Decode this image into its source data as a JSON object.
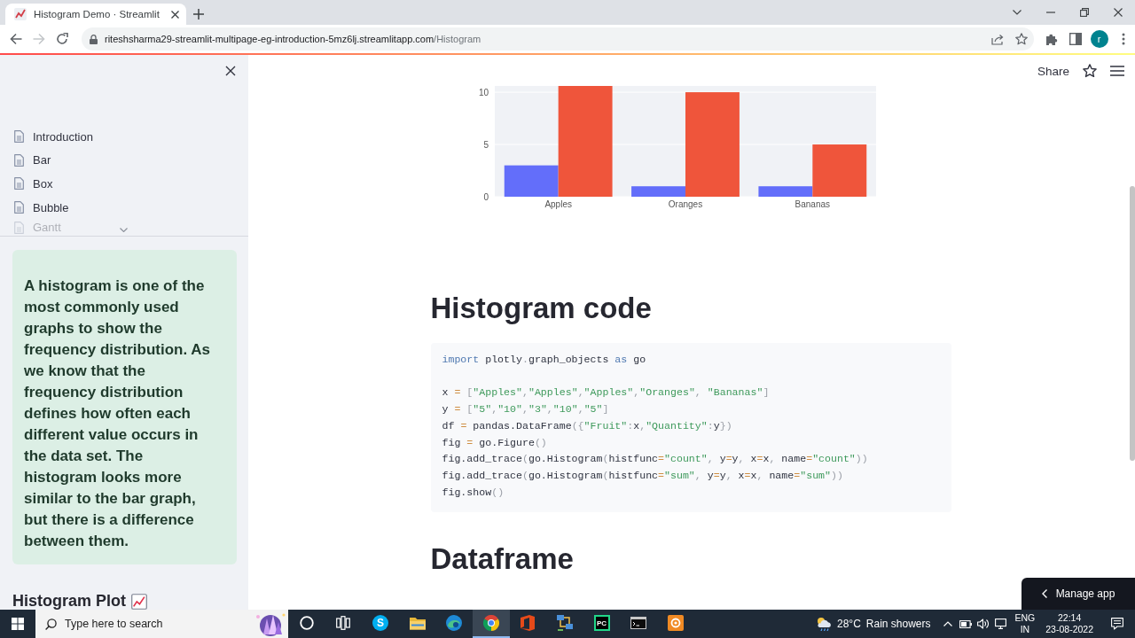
{
  "browser": {
    "tab": {
      "title": "Histogram Demo · Streamlit",
      "selected": true
    },
    "nav_buttons": [
      {
        "kind": "back",
        "disabled": false
      },
      {
        "kind": "forward",
        "disabled": true
      },
      {
        "kind": "reload",
        "disabled": false
      }
    ],
    "url": {
      "host": "riteshsharma29-streamlit-multipage-eg-introduction-5mz6lj.streamlitapp.com",
      "path": "/Histogram"
    },
    "profile_initial": "r"
  },
  "sidebar": {
    "nav_items": [
      {
        "label": "Introduction",
        "selected": false,
        "faded": false
      },
      {
        "label": "Bar",
        "selected": false,
        "faded": false
      },
      {
        "label": "Box",
        "selected": false,
        "faded": false
      },
      {
        "label": "Bubble",
        "selected": false,
        "faded": false
      },
      {
        "label": "Gantt",
        "selected": false,
        "faded": true
      }
    ],
    "callout": "A histogram is one of the most commonly used graphs to show the frequency distribution. As we know that the frequency distribution defines how often each different value occurs in the data set. The histogram looks more similar to the bar graph, but there is a difference between them.",
    "heading": "Histogram Plot"
  },
  "header": {
    "share": "Share"
  },
  "main": {
    "chart_data": {
      "type": "bar",
      "categories": [
        "Apples",
        "Oranges",
        "Bananas"
      ],
      "series": [
        {
          "color": "#636efa",
          "values": [
            3,
            1,
            1
          ]
        },
        {
          "color": "#ef553b",
          "values": [
            10.6,
            10,
            5
          ]
        }
      ],
      "ylim": [
        0,
        10.6
      ],
      "yticks": [
        0,
        5,
        10
      ]
    },
    "sections": [
      {
        "heading": "Histogram code",
        "code": [
          {
            "kind": "code",
            "tokens": [
              {
                "kind": "keyword",
                "text": "import"
              },
              {
                "kind": "name",
                "text": " plotly"
              },
              {
                "kind": "punct",
                "text": "."
              },
              {
                "kind": "name",
                "text": "graph_objects "
              },
              {
                "kind": "keyword",
                "text": "as"
              },
              {
                "kind": "name",
                "text": " go"
              }
            ]
          },
          {
            "kind": "blank"
          },
          {
            "kind": "code",
            "tokens": [
              {
                "kind": "name",
                "text": "x "
              },
              {
                "kind": "op",
                "text": "="
              },
              {
                "kind": "punct",
                "text": " ["
              },
              {
                "kind": "string",
                "text": "\"Apples\""
              },
              {
                "kind": "punct",
                "text": ","
              },
              {
                "kind": "string",
                "text": "\"Apples\""
              },
              {
                "kind": "punct",
                "text": ","
              },
              {
                "kind": "string",
                "text": "\"Apples\""
              },
              {
                "kind": "punct",
                "text": ","
              },
              {
                "kind": "string",
                "text": "\"Oranges\""
              },
              {
                "kind": "punct",
                "text": ", "
              },
              {
                "kind": "string",
                "text": "\"Bananas\""
              },
              {
                "kind": "punct",
                "text": "]"
              }
            ]
          },
          {
            "kind": "code",
            "tokens": [
              {
                "kind": "name",
                "text": "y "
              },
              {
                "kind": "op",
                "text": "="
              },
              {
                "kind": "punct",
                "text": " ["
              },
              {
                "kind": "string",
                "text": "\"5\""
              },
              {
                "kind": "punct",
                "text": ","
              },
              {
                "kind": "string",
                "text": "\"10\""
              },
              {
                "kind": "punct",
                "text": ","
              },
              {
                "kind": "string",
                "text": "\"3\""
              },
              {
                "kind": "punct",
                "text": ","
              },
              {
                "kind": "string",
                "text": "\"10\""
              },
              {
                "kind": "punct",
                "text": ","
              },
              {
                "kind": "string",
                "text": "\"5\""
              },
              {
                "kind": "punct",
                "text": "]"
              }
            ]
          },
          {
            "kind": "code",
            "tokens": [
              {
                "kind": "name",
                "text": "df "
              },
              {
                "kind": "op",
                "text": "="
              },
              {
                "kind": "name",
                "text": " pandas.DataFrame"
              },
              {
                "kind": "punct",
                "text": "({"
              },
              {
                "kind": "string",
                "text": "\"Fruit\""
              },
              {
                "kind": "punct",
                "text": ":"
              },
              {
                "kind": "name",
                "text": "x"
              },
              {
                "kind": "punct",
                "text": ","
              },
              {
                "kind": "string",
                "text": "\"Quantity\""
              },
              {
                "kind": "punct",
                "text": ":"
              },
              {
                "kind": "name",
                "text": "y"
              },
              {
                "kind": "punct",
                "text": "})"
              }
            ]
          },
          {
            "kind": "code",
            "tokens": [
              {
                "kind": "name",
                "text": "fig "
              },
              {
                "kind": "op",
                "text": "="
              },
              {
                "kind": "name",
                "text": " go.Figure"
              },
              {
                "kind": "punct",
                "text": "()"
              }
            ]
          },
          {
            "kind": "code",
            "tokens": [
              {
                "kind": "name",
                "text": "fig.add_trace"
              },
              {
                "kind": "punct",
                "text": "("
              },
              {
                "kind": "name",
                "text": "go.Histogram"
              },
              {
                "kind": "punct",
                "text": "("
              },
              {
                "kind": "name",
                "text": "histfunc"
              },
              {
                "kind": "op",
                "text": "="
              },
              {
                "kind": "string",
                "text": "\"count\""
              },
              {
                "kind": "punct",
                "text": ", "
              },
              {
                "kind": "name",
                "text": "y"
              },
              {
                "kind": "op",
                "text": "="
              },
              {
                "kind": "name",
                "text": "y"
              },
              {
                "kind": "punct",
                "text": ", "
              },
              {
                "kind": "name",
                "text": "x"
              },
              {
                "kind": "op",
                "text": "="
              },
              {
                "kind": "name",
                "text": "x"
              },
              {
                "kind": "punct",
                "text": ", "
              },
              {
                "kind": "name",
                "text": "name"
              },
              {
                "kind": "op",
                "text": "="
              },
              {
                "kind": "string",
                "text": "\"count\""
              },
              {
                "kind": "punct",
                "text": "))"
              }
            ]
          },
          {
            "kind": "code",
            "tokens": [
              {
                "kind": "name",
                "text": "fig.add_trace"
              },
              {
                "kind": "punct",
                "text": "("
              },
              {
                "kind": "name",
                "text": "go.Histogram"
              },
              {
                "kind": "punct",
                "text": "("
              },
              {
                "kind": "name",
                "text": "histfunc"
              },
              {
                "kind": "op",
                "text": "="
              },
              {
                "kind": "string",
                "text": "\"sum\""
              },
              {
                "kind": "punct",
                "text": ", "
              },
              {
                "kind": "name",
                "text": "y"
              },
              {
                "kind": "op",
                "text": "="
              },
              {
                "kind": "name",
                "text": "y"
              },
              {
                "kind": "punct",
                "text": ", "
              },
              {
                "kind": "name",
                "text": "x"
              },
              {
                "kind": "op",
                "text": "="
              },
              {
                "kind": "name",
                "text": "x"
              },
              {
                "kind": "punct",
                "text": ", "
              },
              {
                "kind": "name",
                "text": "name"
              },
              {
                "kind": "op",
                "text": "="
              },
              {
                "kind": "string",
                "text": "\"sum\""
              },
              {
                "kind": "punct",
                "text": "))"
              }
            ]
          },
          {
            "kind": "code",
            "tokens": [
              {
                "kind": "name",
                "text": "fig.show"
              },
              {
                "kind": "punct",
                "text": "()"
              }
            ]
          }
        ]
      },
      {
        "heading": "Dataframe"
      }
    ]
  },
  "manage_app": "Manage app",
  "taskbar": {
    "search": {
      "placeholder": "Type here to search"
    },
    "apps": [
      {
        "kind": "cortana",
        "active": false
      },
      {
        "kind": "task-view",
        "active": false
      },
      {
        "kind": "skype",
        "glyph": "S",
        "active": false
      },
      {
        "kind": "files",
        "active": false
      },
      {
        "kind": "edge",
        "active": false
      },
      {
        "kind": "chrome",
        "active": true
      },
      {
        "kind": "office",
        "active": false
      },
      {
        "kind": "network",
        "active": false
      },
      {
        "kind": "pycharm",
        "glyph": "PC",
        "active": false
      },
      {
        "kind": "terminal",
        "active": false
      },
      {
        "kind": "orange-app",
        "active": false
      }
    ],
    "weather": {
      "temperature": "28°C",
      "condition": "Rain showers"
    },
    "language": {
      "code": "ENG",
      "region": "IN"
    },
    "time": "22:14",
    "date": "23-08-2022"
  }
}
